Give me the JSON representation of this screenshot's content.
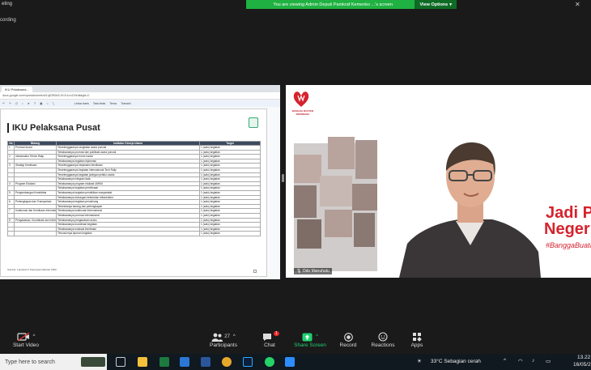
{
  "window": {
    "title_fragment": "eting",
    "recording_fragment": "cording"
  },
  "banner": {
    "message": "You are viewing Admin Deputi Pamkraf Kemenko ...'s screen",
    "view_options": "View Options"
  },
  "shared_screen": {
    "browser_tab": "IKU Pelaksana...",
    "url": "docs.google.com/spreadsheets/d/1qE2B9dX-Kh7uLmZ0/edit#gid=0",
    "sheet_toolbar": [
      "Lebar baris",
      "Tata letak",
      "Tema",
      "Transisi"
    ],
    "slide": {
      "title": "IKU Pelaksana Pusat",
      "table_headers": [
        "No",
        "Bidang",
        "Indikator Kinerja Utama",
        "Target"
      ],
      "rows": [
        {
          "no": "1",
          "bidang": "Promosi Acara",
          "iku": "Terselenggaranya rangkaian acara puncak",
          "target": "1 (satu) kegiatan"
        },
        {
          "no": "",
          "bidang": "",
          "iku": "Terlaksananya promosi dan publikasi acara puncak",
          "target": "1 (satu) kegiatan"
        },
        {
          "no": "2",
          "bidang": "Infrastruktur Teknis Rakp",
          "iku": "Terselenggaranya forum kurasi",
          "target": "1 (satu) kegiatan"
        },
        {
          "no": "",
          "bidang": "",
          "iku": "Terlaksananya kegiatan diplomasi",
          "target": "1 (satu) kegiatan"
        },
        {
          "no": "3",
          "bidang": "Strategi Kemitraan",
          "iku": "Terselenggaranya kerjasama kemitraan",
          "target": "1 (satu) kegiatan"
        },
        {
          "no": "",
          "bidang": "",
          "iku": "Terselenggaranya kegiatan internasional Tech Rally",
          "target": "1 (satu) kegiatan"
        },
        {
          "no": "",
          "bidang": "",
          "iku": "Terselenggaranya kegiatan jaringan pelaku usaha",
          "target": "1 (satu) kegiatan"
        },
        {
          "no": "",
          "bidang": "",
          "iku": "Terlaksananya integrasi data",
          "target": "1 (satu) kegiatan"
        },
        {
          "no": "4",
          "bidang": "Program Edukasi",
          "iku": "Terlaksananya program edukasi UMKM",
          "target": "1 (satu) kegiatan"
        },
        {
          "no": "",
          "bidang": "",
          "iku": "Terlaksananya kegiatan pembinaan",
          "target": "1 (satu) kegiatan"
        },
        {
          "no": "5",
          "bidang": "Pengembangan Kreativitas",
          "iku": "Terlaksananya kegiatan pendidikan masyarakat",
          "target": "1 (satu) kegiatan"
        },
        {
          "no": "",
          "bidang": "",
          "iku": "Terlaksananya dukungan kebutuhan infrastruktur",
          "target": "1 (satu) kegiatan"
        },
        {
          "no": "6",
          "bidang": "Perlengkapan dan Transportasi",
          "iku": "Terlaksananya kegiatan pendukung",
          "target": "1 (satu) kegiatan"
        },
        {
          "no": "",
          "bidang": "",
          "iku": "Terkelolanya barang dan perlengkapan",
          "target": "1 (satu) kegiatan"
        },
        {
          "no": "7",
          "bidang": "Kolaborasi dan Kemitraan Internasional",
          "iku": "Terlaksananya kolaborasi internasional",
          "target": "1 (satu) kegiatan"
        },
        {
          "no": "",
          "bidang": "",
          "iku": "Terlaksananya promosi internasional",
          "target": "1 (satu) kegiatan"
        },
        {
          "no": "8",
          "bidang": "Pengawasan, Koordinasi dan Keberlanjutan Kemitraan",
          "iku": "Terlaksananya pengawasan acara",
          "target": "1 (satu) kegiatan"
        },
        {
          "no": "",
          "bidang": "",
          "iku": "Terlaksananya koordinasi kegiatan",
          "target": "1 (satu) kegiatan"
        },
        {
          "no": "",
          "bidang": "",
          "iku": "Terlaksananya evaluasi kemitraan",
          "target": "1 (satu) kegiatan"
        },
        {
          "no": "",
          "bidang": "",
          "iku": "Tersusunnya laporan kegiatan",
          "target": "1 (satu) kegiatan"
        }
      ],
      "source": "Sumber: Lampiran II Keputusan Menteri 2023"
    }
  },
  "video": {
    "logo_text": "BANGGA BUATAN INDONESIA",
    "slogan_line1": "Jadi Pahlaw",
    "slogan_line2": "Negeri den",
    "hashtag": "#BanggaBuatanIndonesia",
    "name_tag": "Odo Manuhutu"
  },
  "controls": {
    "start_video": "Start Video",
    "participants": "Participants",
    "participants_count": "27",
    "chat": "Chat",
    "chat_badge": "1",
    "share_screen": "Share Screen",
    "record": "Record",
    "reactions": "Reactions",
    "apps": "Apps"
  },
  "taskbar": {
    "search_placeholder": "Type here to search",
    "weather": "33°C  Sebagian cerah",
    "time": "13.22",
    "date": "16/05/2"
  },
  "colors": {
    "zoom_green": "#1fb141",
    "brand_red": "#d4232d",
    "table_header": "#3b4a5e"
  }
}
